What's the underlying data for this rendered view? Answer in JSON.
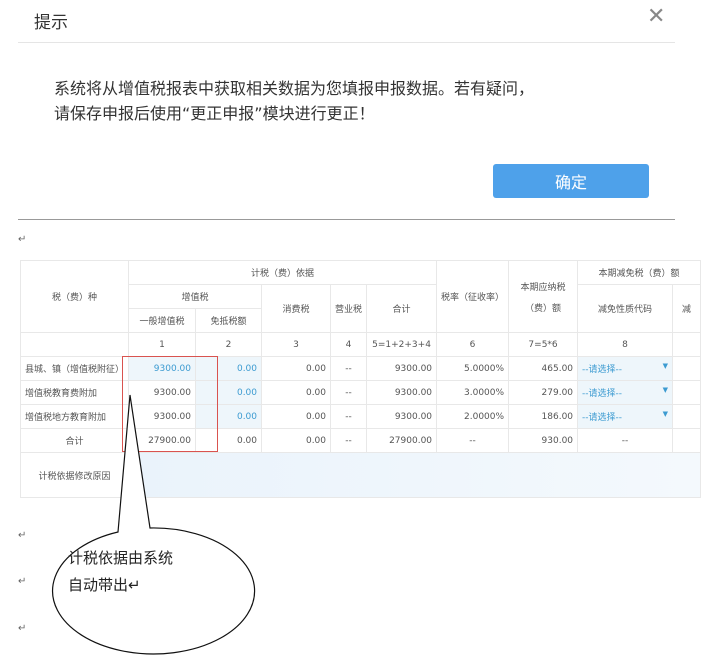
{
  "dialog": {
    "title": "提示",
    "close_icon": "close-icon",
    "message_line1": "系统将从增值税报表中获取相关数据为您填报申报数据。若有疑问，",
    "message_line2": "请保存申报后使用“更正申报”模块进行更正！",
    "ok_label": "确定",
    "ok_color": "#4ea1ea"
  },
  "return_mark": "↵",
  "table": {
    "h_tax_type": "税（费）种",
    "h_basis": "计税（费）依据",
    "h_vat": "增值税",
    "h_general_vat": "一般增值税",
    "h_exempt": "免抵税额",
    "h_consumption": "消费税",
    "h_business": "营业税",
    "h_total": "合计",
    "h_rate": "税率（征收率）",
    "h_payable_1": "本期应纳税",
    "h_payable_2": "（费）额",
    "h_reduction": "本期减免税（费）额",
    "h_reduction_code": "减免性质代码",
    "h_cut": "减",
    "index": [
      "1",
      "2",
      "3",
      "4",
      "5=1+2+3+4",
      "6",
      "7=5*6",
      "8"
    ],
    "rows": [
      {
        "name": "县城、镇（增值税附征）",
        "general_vat": "9300.00",
        "exempt": "0.00",
        "consumption": "0.00",
        "business": "--",
        "total": "9300.00",
        "rate": "5.0000%",
        "payable": "465.00",
        "code": "--请选择--"
      },
      {
        "name": "增值税教育费附加",
        "general_vat": "9300.00",
        "exempt": "0.00",
        "consumption": "0.00",
        "business": "--",
        "total": "9300.00",
        "rate": "3.0000%",
        "payable": "279.00",
        "code": "--请选择--"
      },
      {
        "name": "增值税地方教育附加",
        "general_vat": "9300.00",
        "exempt": "0.00",
        "consumption": "0.00",
        "business": "--",
        "total": "9300.00",
        "rate": "2.0000%",
        "payable": "186.00",
        "code": "--请选择--"
      }
    ],
    "sum": {
      "name": "合计",
      "general_vat": "27900.00",
      "exempt": "0.00",
      "consumption": "0.00",
      "business": "--",
      "total": "27900.00",
      "rate": "--",
      "payable": "930.00",
      "code": "--"
    },
    "reason_label": "计税依据修改原因"
  },
  "callout": {
    "line1": "计税依据由系统",
    "line2": "自动带出↵"
  }
}
